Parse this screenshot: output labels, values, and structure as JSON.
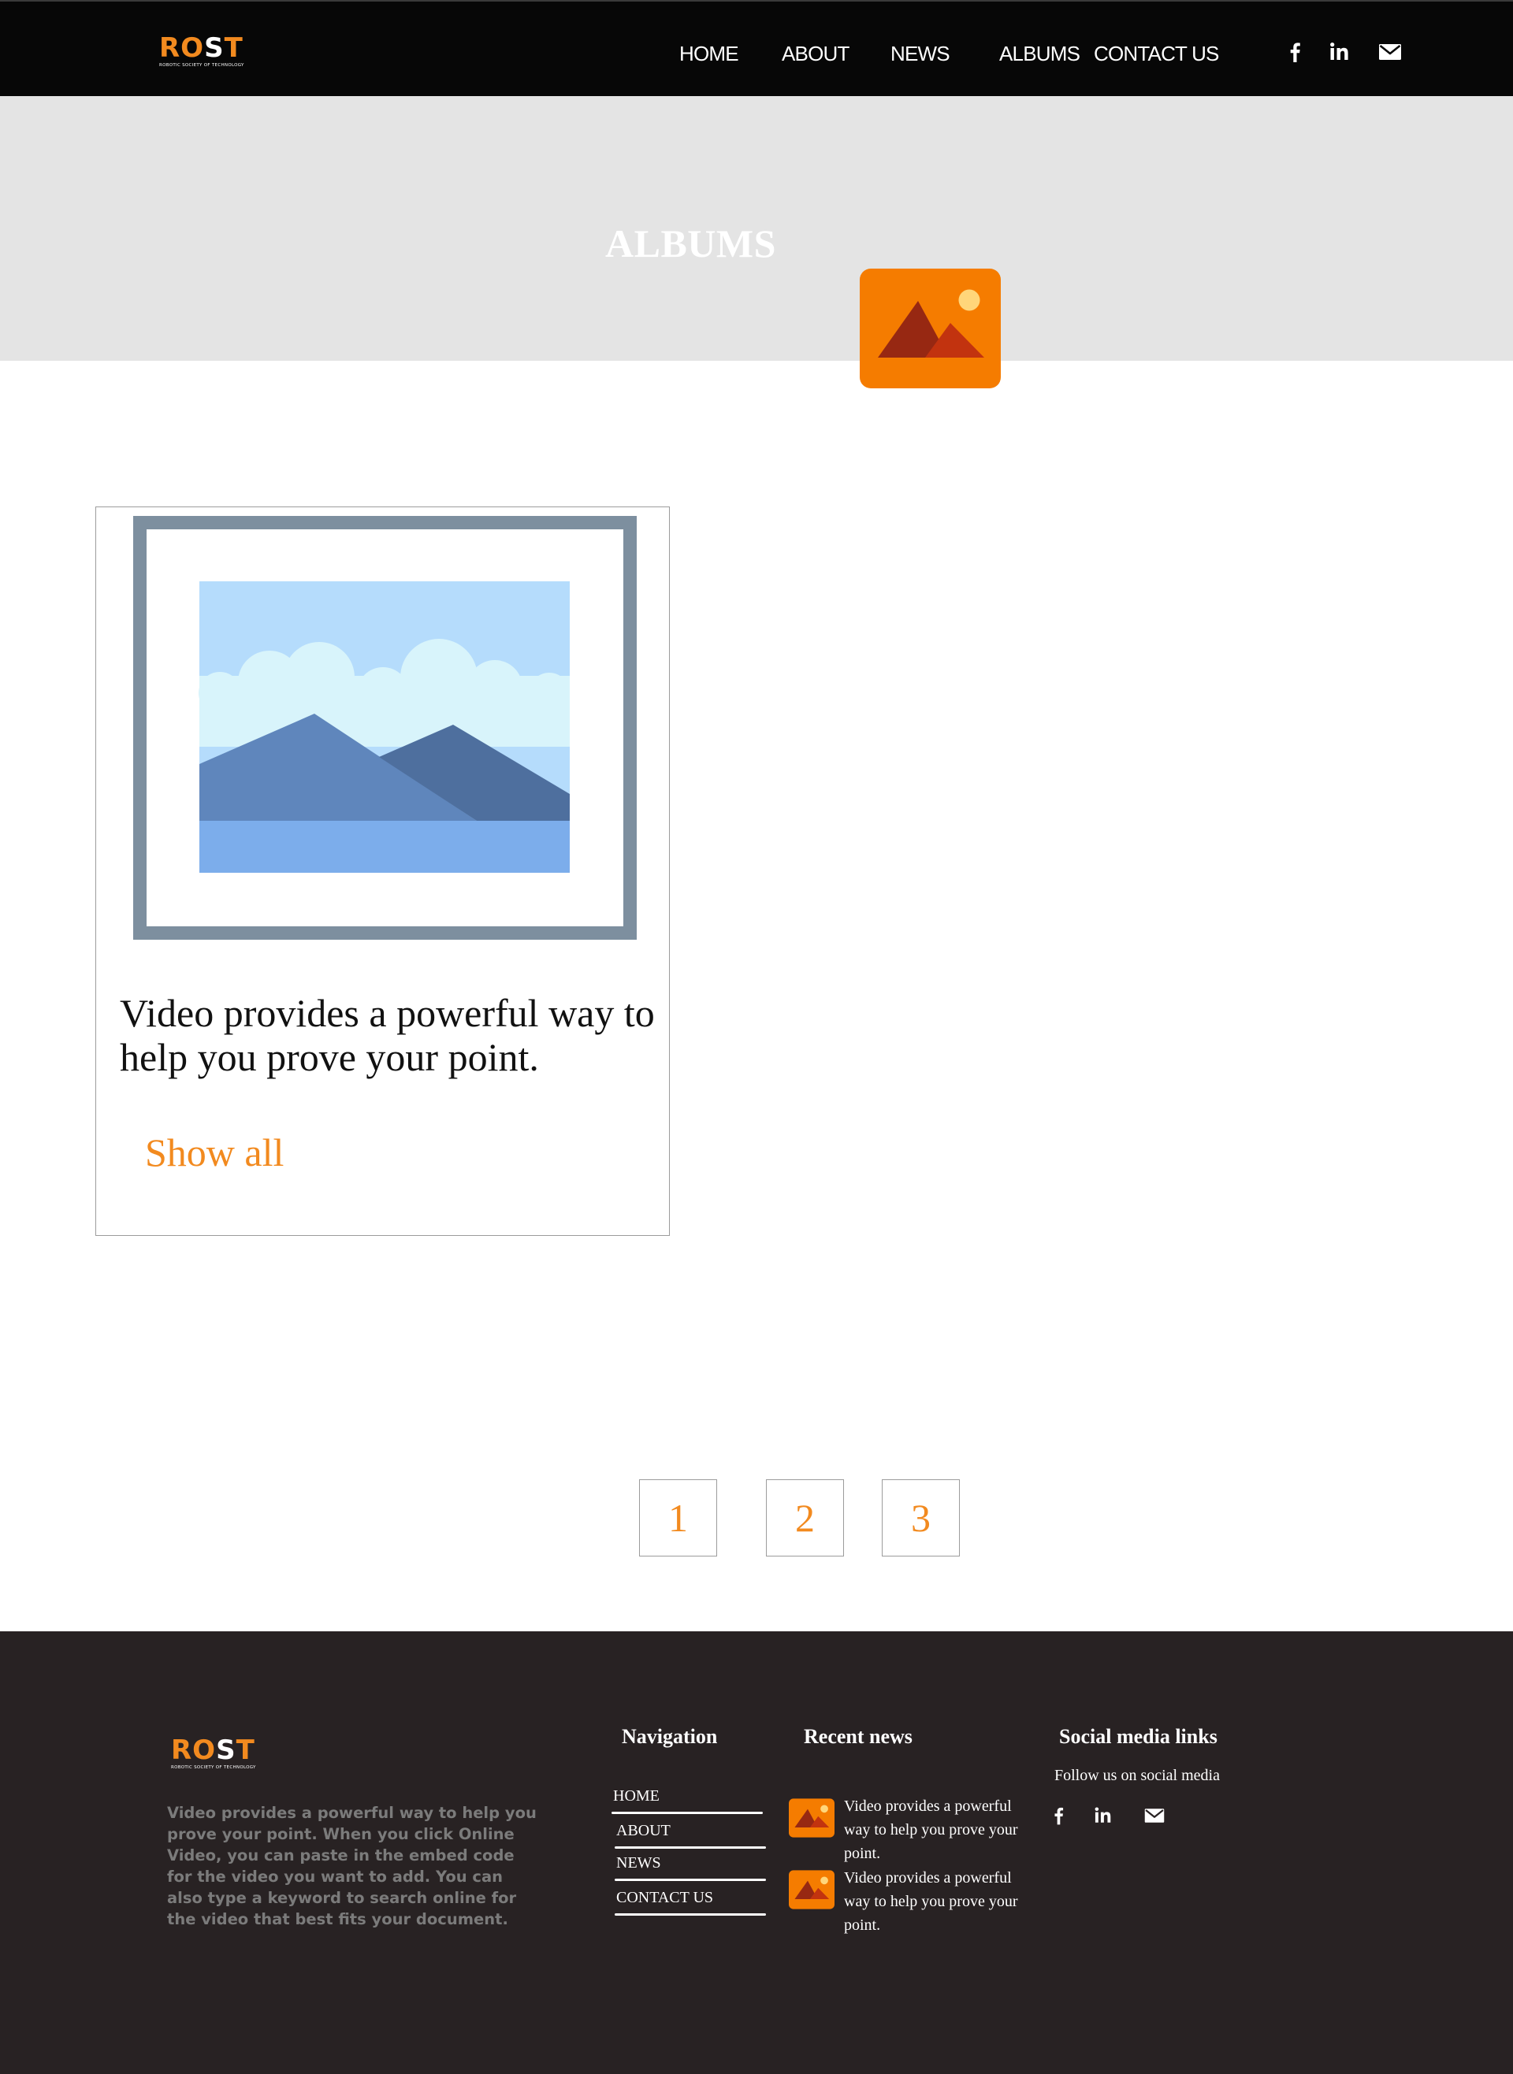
{
  "brand": {
    "logo_main_orange": "RO",
    "logo_main_white": "S",
    "logo_main_tail": "T",
    "logo_sub": "ROBOTIC SOCIETY OF TECHNOLOGY"
  },
  "header": {
    "nav": [
      {
        "label": "HOME"
      },
      {
        "label": "ABOUT"
      },
      {
        "label": "NEWS"
      },
      {
        "label": "ALBUMS"
      },
      {
        "label": "CONTACT US"
      }
    ],
    "social_icons": [
      "facebook-icon",
      "linkedin-icon",
      "mail-icon"
    ]
  },
  "banner": {
    "title": "ALBUMS",
    "icon": "image-icon"
  },
  "album": {
    "icon": "picture-frame-icon",
    "text": "Video provides a powerful way to help you prove your point.",
    "link_label": "Show all"
  },
  "pagination": [
    "1",
    "2",
    "3"
  ],
  "footer": {
    "description": "Video provides a powerful way to help you prove your point. When you click Online Video, you can paste in the embed code for the video you want to add. You can also type a keyword to search online for the video that best fits your document.",
    "navigation_title": "Navigation",
    "navigation": [
      {
        "label": "HOME"
      },
      {
        "label": "ABOUT"
      },
      {
        "label": "NEWS"
      },
      {
        "label": "CONTACT US"
      }
    ],
    "recent_news_title": "Recent news",
    "recent_news": [
      {
        "text": "Video provides a powerful way to help you prove your point."
      },
      {
        "text": "Video provides a powerful way to help you prove your point."
      }
    ],
    "social_title": "Social media links",
    "follow_text": "Follow us on social media"
  },
  "colors": {
    "accent": "#f28a1f",
    "header_bg": "#070707",
    "banner_bg": "#e4e4e4",
    "footer_bg": "#282223"
  }
}
